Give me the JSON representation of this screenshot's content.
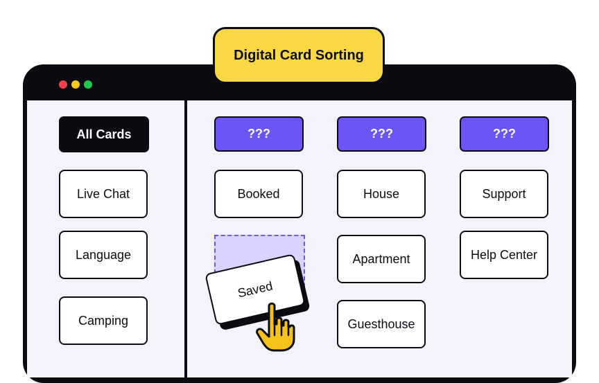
{
  "title": "Digital Card Sorting",
  "window_controls": [
    "close",
    "minimize",
    "maximize"
  ],
  "sidebar": {
    "active_label": "All Cards",
    "cards": [
      "Live Chat",
      "Language",
      "Camping"
    ]
  },
  "columns": [
    {
      "header": "???",
      "cards": [
        "Booked"
      ]
    },
    {
      "header": "???",
      "cards": [
        "House",
        "Apartment",
        "Guesthouse"
      ]
    },
    {
      "header": "???",
      "cards": [
        "Support",
        "Help Center"
      ]
    }
  ],
  "dragging": {
    "label": "Saved",
    "cursor_icon": "pointer-hand-icon"
  },
  "colors": {
    "accent": "#6c55f6",
    "title_bg": "#f8d844",
    "frame": "#0b0b12",
    "content_bg": "#f4f3fb",
    "dropzone": "#d9d4ff"
  }
}
